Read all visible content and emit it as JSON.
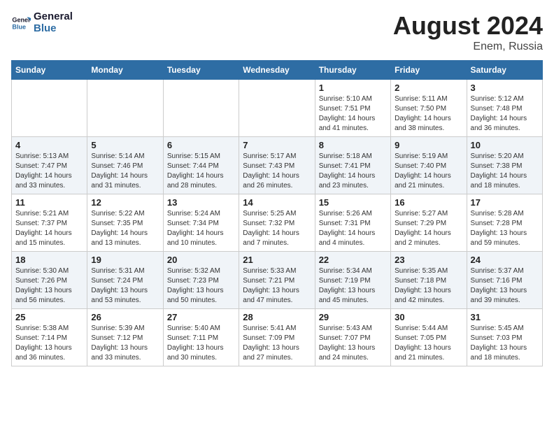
{
  "header": {
    "logo_general": "General",
    "logo_blue": "Blue",
    "title": "August 2024",
    "subtitle": "Enem, Russia"
  },
  "days_of_week": [
    "Sunday",
    "Monday",
    "Tuesday",
    "Wednesday",
    "Thursday",
    "Friday",
    "Saturday"
  ],
  "weeks": [
    [
      {
        "day": "",
        "info": ""
      },
      {
        "day": "",
        "info": ""
      },
      {
        "day": "",
        "info": ""
      },
      {
        "day": "",
        "info": ""
      },
      {
        "day": "1",
        "info": "Sunrise: 5:10 AM\nSunset: 7:51 PM\nDaylight: 14 hours\nand 41 minutes."
      },
      {
        "day": "2",
        "info": "Sunrise: 5:11 AM\nSunset: 7:50 PM\nDaylight: 14 hours\nand 38 minutes."
      },
      {
        "day": "3",
        "info": "Sunrise: 5:12 AM\nSunset: 7:48 PM\nDaylight: 14 hours\nand 36 minutes."
      }
    ],
    [
      {
        "day": "4",
        "info": "Sunrise: 5:13 AM\nSunset: 7:47 PM\nDaylight: 14 hours\nand 33 minutes."
      },
      {
        "day": "5",
        "info": "Sunrise: 5:14 AM\nSunset: 7:46 PM\nDaylight: 14 hours\nand 31 minutes."
      },
      {
        "day": "6",
        "info": "Sunrise: 5:15 AM\nSunset: 7:44 PM\nDaylight: 14 hours\nand 28 minutes."
      },
      {
        "day": "7",
        "info": "Sunrise: 5:17 AM\nSunset: 7:43 PM\nDaylight: 14 hours\nand 26 minutes."
      },
      {
        "day": "8",
        "info": "Sunrise: 5:18 AM\nSunset: 7:41 PM\nDaylight: 14 hours\nand 23 minutes."
      },
      {
        "day": "9",
        "info": "Sunrise: 5:19 AM\nSunset: 7:40 PM\nDaylight: 14 hours\nand 21 minutes."
      },
      {
        "day": "10",
        "info": "Sunrise: 5:20 AM\nSunset: 7:38 PM\nDaylight: 14 hours\nand 18 minutes."
      }
    ],
    [
      {
        "day": "11",
        "info": "Sunrise: 5:21 AM\nSunset: 7:37 PM\nDaylight: 14 hours\nand 15 minutes."
      },
      {
        "day": "12",
        "info": "Sunrise: 5:22 AM\nSunset: 7:35 PM\nDaylight: 14 hours\nand 13 minutes."
      },
      {
        "day": "13",
        "info": "Sunrise: 5:24 AM\nSunset: 7:34 PM\nDaylight: 14 hours\nand 10 minutes."
      },
      {
        "day": "14",
        "info": "Sunrise: 5:25 AM\nSunset: 7:32 PM\nDaylight: 14 hours\nand 7 minutes."
      },
      {
        "day": "15",
        "info": "Sunrise: 5:26 AM\nSunset: 7:31 PM\nDaylight: 14 hours\nand 4 minutes."
      },
      {
        "day": "16",
        "info": "Sunrise: 5:27 AM\nSunset: 7:29 PM\nDaylight: 14 hours\nand 2 minutes."
      },
      {
        "day": "17",
        "info": "Sunrise: 5:28 AM\nSunset: 7:28 PM\nDaylight: 13 hours\nand 59 minutes."
      }
    ],
    [
      {
        "day": "18",
        "info": "Sunrise: 5:30 AM\nSunset: 7:26 PM\nDaylight: 13 hours\nand 56 minutes."
      },
      {
        "day": "19",
        "info": "Sunrise: 5:31 AM\nSunset: 7:24 PM\nDaylight: 13 hours\nand 53 minutes."
      },
      {
        "day": "20",
        "info": "Sunrise: 5:32 AM\nSunset: 7:23 PM\nDaylight: 13 hours\nand 50 minutes."
      },
      {
        "day": "21",
        "info": "Sunrise: 5:33 AM\nSunset: 7:21 PM\nDaylight: 13 hours\nand 47 minutes."
      },
      {
        "day": "22",
        "info": "Sunrise: 5:34 AM\nSunset: 7:19 PM\nDaylight: 13 hours\nand 45 minutes."
      },
      {
        "day": "23",
        "info": "Sunrise: 5:35 AM\nSunset: 7:18 PM\nDaylight: 13 hours\nand 42 minutes."
      },
      {
        "day": "24",
        "info": "Sunrise: 5:37 AM\nSunset: 7:16 PM\nDaylight: 13 hours\nand 39 minutes."
      }
    ],
    [
      {
        "day": "25",
        "info": "Sunrise: 5:38 AM\nSunset: 7:14 PM\nDaylight: 13 hours\nand 36 minutes."
      },
      {
        "day": "26",
        "info": "Sunrise: 5:39 AM\nSunset: 7:12 PM\nDaylight: 13 hours\nand 33 minutes."
      },
      {
        "day": "27",
        "info": "Sunrise: 5:40 AM\nSunset: 7:11 PM\nDaylight: 13 hours\nand 30 minutes."
      },
      {
        "day": "28",
        "info": "Sunrise: 5:41 AM\nSunset: 7:09 PM\nDaylight: 13 hours\nand 27 minutes."
      },
      {
        "day": "29",
        "info": "Sunrise: 5:43 AM\nSunset: 7:07 PM\nDaylight: 13 hours\nand 24 minutes."
      },
      {
        "day": "30",
        "info": "Sunrise: 5:44 AM\nSunset: 7:05 PM\nDaylight: 13 hours\nand 21 minutes."
      },
      {
        "day": "31",
        "info": "Sunrise: 5:45 AM\nSunset: 7:03 PM\nDaylight: 13 hours\nand 18 minutes."
      }
    ]
  ]
}
